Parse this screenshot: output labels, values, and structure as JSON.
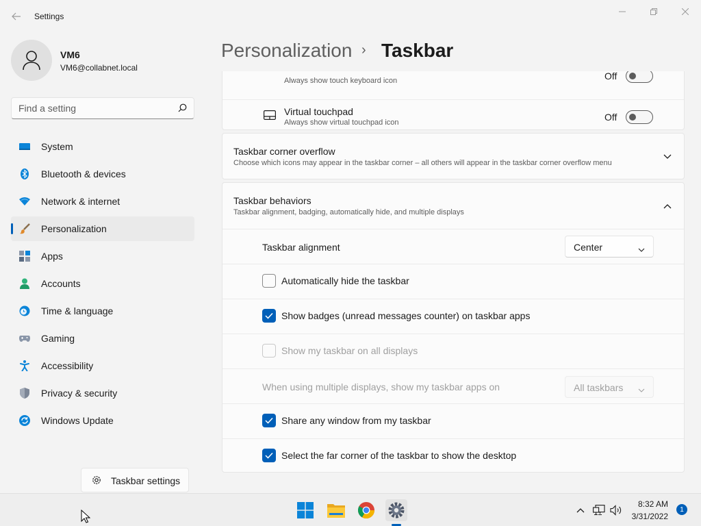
{
  "window": {
    "title": "Settings",
    "back_icon": "arrow-left-icon",
    "controls": [
      "minimize-icon",
      "maximize-icon",
      "close-icon"
    ]
  },
  "user": {
    "name": "VM6",
    "email": "VM6@collabnet.local",
    "avatar_icon": "person-icon"
  },
  "search": {
    "placeholder": "Find a setting",
    "icon": "search-icon"
  },
  "nav": {
    "items": [
      {
        "label": "System",
        "icon": "monitor-icon",
        "selected": false
      },
      {
        "label": "Bluetooth & devices",
        "icon": "bluetooth-icon",
        "selected": false
      },
      {
        "label": "Network & internet",
        "icon": "wifi-icon",
        "selected": false
      },
      {
        "label": "Personalization",
        "icon": "paintbrush-icon",
        "selected": true
      },
      {
        "label": "Apps",
        "icon": "apps-icon",
        "selected": false
      },
      {
        "label": "Accounts",
        "icon": "accounts-icon",
        "selected": false
      },
      {
        "label": "Time & language",
        "icon": "clock-globe-icon",
        "selected": false
      },
      {
        "label": "Gaming",
        "icon": "gamepad-icon",
        "selected": false
      },
      {
        "label": "Accessibility",
        "icon": "accessibility-icon",
        "selected": false
      },
      {
        "label": "Privacy & security",
        "icon": "shield-icon",
        "selected": false
      },
      {
        "label": "Windows Update",
        "icon": "update-icon",
        "selected": false
      }
    ]
  },
  "tooltip_button": {
    "label": "Taskbar settings",
    "icon": "gear-icon"
  },
  "header": {
    "parent": "Personalization",
    "separator": "›",
    "current": "Taskbar"
  },
  "touch_keyboard": {
    "subtitle": "Always show touch keyboard icon",
    "state": "Off"
  },
  "virtual_touchpad": {
    "title": "Virtual touchpad",
    "subtitle": "Always show virtual touchpad icon",
    "state": "Off",
    "icon": "touchpad-icon"
  },
  "corner_overflow": {
    "title": "Taskbar corner overflow",
    "subtitle": "Choose which icons may appear in the taskbar corner – all others will appear in the taskbar corner overflow menu",
    "expanded": false
  },
  "behaviors": {
    "title": "Taskbar behaviors",
    "subtitle": "Taskbar alignment, badging, automatically hide, and multiple displays",
    "expanded": true,
    "alignment_label": "Taskbar alignment",
    "alignment_value": "Center",
    "auto_hide": {
      "label": "Automatically hide the taskbar",
      "checked": false,
      "disabled": false
    },
    "badges": {
      "label": "Show badges (unread messages counter) on taskbar apps",
      "checked": true,
      "disabled": false
    },
    "all_displays": {
      "label": "Show my taskbar on all displays",
      "checked": false,
      "disabled": true
    },
    "multi_display_label": "When using multiple displays, show my taskbar apps on",
    "multi_display_value": "All taskbars",
    "share_window": {
      "label": "Share any window from my taskbar",
      "checked": true,
      "disabled": false
    },
    "far_corner": {
      "label": "Select the far corner of the taskbar to show the desktop",
      "checked": true,
      "disabled": false
    }
  },
  "taskbar": {
    "apps": [
      "windows-start-icon",
      "file-explorer-icon",
      "chrome-icon",
      "settings-app-icon"
    ],
    "tray": [
      "chevron-up-icon",
      "network-icon",
      "volume-icon"
    ],
    "time": "8:32 AM",
    "date": "3/31/2022",
    "notifications": "1"
  },
  "colors": {
    "accent": "#005fb8",
    "background": "#f3f3f3",
    "card": "#fbfbfb"
  }
}
